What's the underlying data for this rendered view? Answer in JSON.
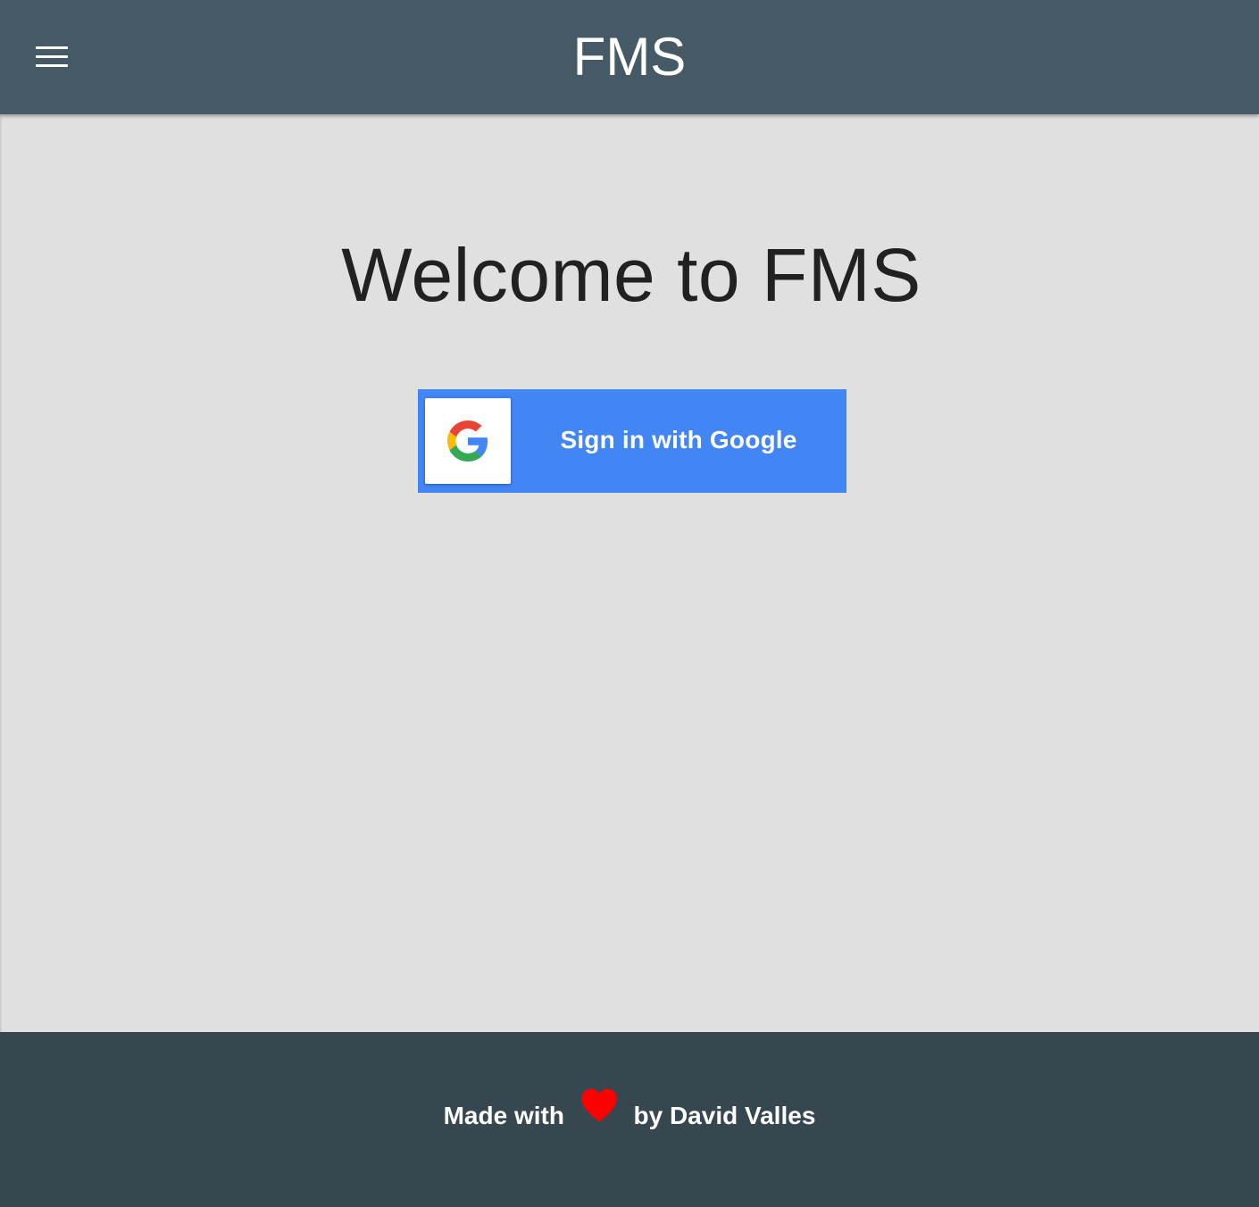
{
  "header": {
    "title": "FMS",
    "menu_icon": "hamburger-menu-icon"
  },
  "main": {
    "welcome_text": "Welcome to FMS",
    "sign_in_button": {
      "label": "Sign in with Google",
      "icon": "google-logo-icon"
    }
  },
  "footer": {
    "made_with": "Made with",
    "heart_icon": "heart-icon",
    "by_author": "by David Valles"
  },
  "colors": {
    "header_bg": "#455a64",
    "page_bg": "#e0e0e0",
    "footer_bg": "#37474f",
    "google_blue": "#4285f4",
    "heart_red": "#ff0000"
  }
}
